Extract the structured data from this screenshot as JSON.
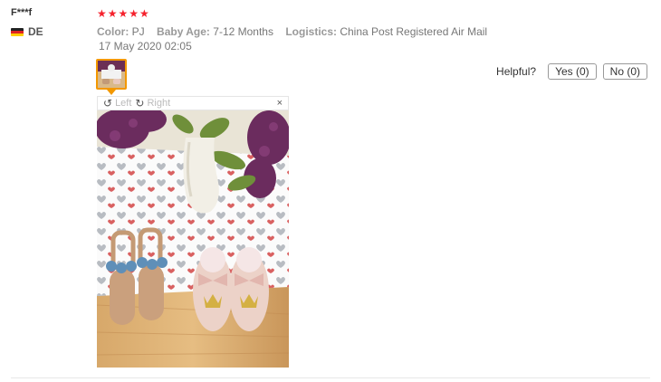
{
  "reviewer": {
    "name": "F***f",
    "country": "DE",
    "flag_icon": "germany-flag-icon"
  },
  "review": {
    "rating_stars": "★★★★★",
    "rating": 5,
    "attributes": [
      {
        "key": "Color:",
        "value": "PJ"
      },
      {
        "key": "Baby Age:",
        "value": "7-12 Months"
      },
      {
        "key": "Logistics:",
        "value": "China Post Registered Air Mail"
      }
    ],
    "date": "17 May 2020 02:05"
  },
  "helpful": {
    "label": "Helpful?",
    "yes": "Yes (0)",
    "no": "No (0)"
  },
  "viewer": {
    "left": "Left",
    "right": "Right",
    "close": "×"
  },
  "colors": {
    "star": "#f5222d",
    "thumb_border": "#f39800"
  }
}
